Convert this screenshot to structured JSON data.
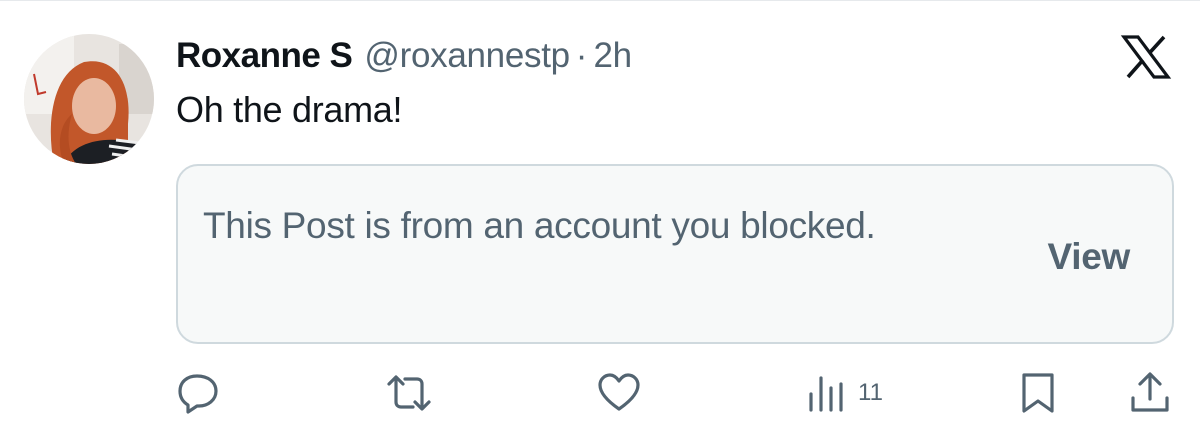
{
  "post": {
    "author_name": "Roxanne S",
    "author_handle": "@roxannestp",
    "separator": "·",
    "timestamp": "2h",
    "text": "Oh the drama!"
  },
  "quoted": {
    "message": "This Post is from an account you blocked.",
    "view_label": "View"
  },
  "actions": {
    "views_count": "11"
  },
  "icons": {
    "brand": "x-logo-icon",
    "reply": "reply-icon",
    "repost": "repost-icon",
    "like": "heart-icon",
    "views": "views-bar-chart-icon",
    "bookmark": "bookmark-icon",
    "share": "share-icon"
  },
  "colors": {
    "text_primary": "#0f1419",
    "text_secondary": "#536471",
    "card_background": "#f7f9f9",
    "card_border": "#cfd9de"
  }
}
